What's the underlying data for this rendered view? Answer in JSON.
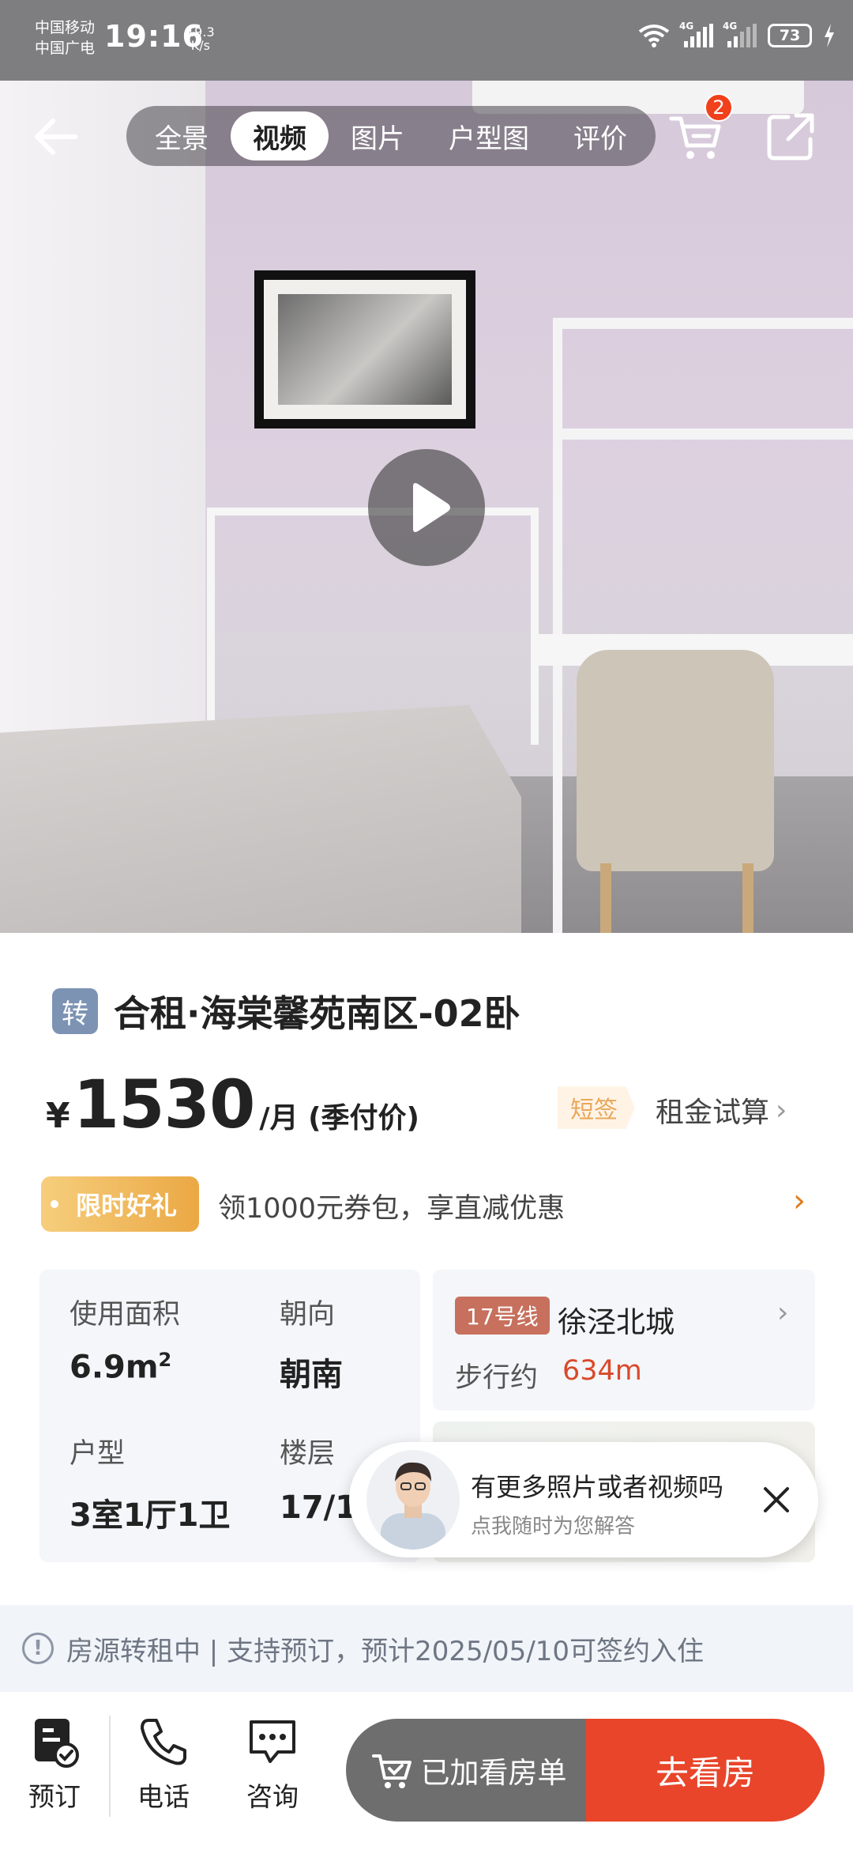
{
  "status_bar": {
    "carrier_1": "中国移动",
    "carrier_2": "中国广电",
    "time": "19:16",
    "net_speed_value": "19.3",
    "net_speed_unit": "K/s",
    "sim_1_label": "4G",
    "sim_2_label": "4G",
    "battery": "73"
  },
  "top_nav": {
    "tabs": [
      {
        "label": "全景",
        "active": false
      },
      {
        "label": "视频",
        "active": true
      },
      {
        "label": "图片",
        "active": false
      },
      {
        "label": "户型图",
        "active": false
      },
      {
        "label": "评价",
        "active": false
      }
    ],
    "cart_badge": "2",
    "icons": {
      "back": "arrow-left-icon",
      "cart": "cart-icon",
      "share": "share-icon",
      "play": "play-icon"
    }
  },
  "listing": {
    "tag": "转",
    "title": "合租·海棠馨苑南区-02卧",
    "currency": "¥",
    "price": "1530",
    "price_unit": "/月 (季付价)",
    "short_lease_tag": "短签",
    "rent_calc_label": "租金试算"
  },
  "promo": {
    "tag": "限时好礼",
    "text": "领1000元券包，享直减优惠"
  },
  "info": {
    "area_label": "使用面积",
    "area_value": "6.9",
    "area_unit": "m",
    "area_sup": "2",
    "orientation_label": "朝向",
    "orientation_value": "朝南",
    "layout_label": "户型",
    "layout_value": "3室1厅1卫",
    "floor_label": "楼层",
    "floor_value": "17/1"
  },
  "metro": {
    "line": "17号线",
    "station": "徐泾北城",
    "walk_label": "步行约",
    "walk_distance": "634m"
  },
  "chat_popup": {
    "title": "有更多照片或者视频吗",
    "subtitle": "点我随时为您解答"
  },
  "notice": {
    "text": "房源转租中 | 支持预订，预计2025/05/10可签约入住"
  },
  "bottom_bar": {
    "reserve_label": "预订",
    "phone_label": "电话",
    "consult_label": "咨询",
    "added_label": "已加看房单",
    "go_label": "去看房"
  },
  "colors": {
    "accent": "#e8452a",
    "price_highlight": "#d9492b",
    "metro_line": "#c7705d",
    "promo_gold": "#eba844",
    "tag_blue": "#7d93b4"
  }
}
